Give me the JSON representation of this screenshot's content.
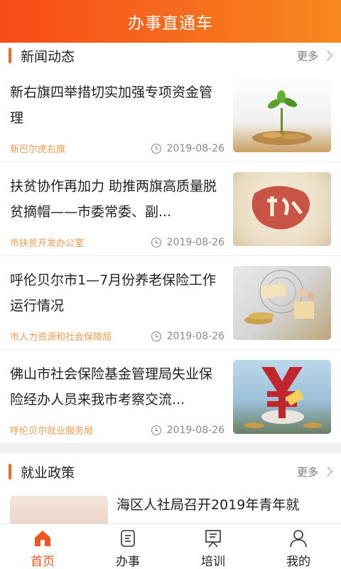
{
  "header": {
    "title": "办事直通车"
  },
  "sections": [
    {
      "title": "新闻动态",
      "more_label": "更多",
      "items": [
        {
          "title": "新右旗四举措切实加强专项资金管理",
          "source": "新巴尔虎右旗",
          "date": "2019-08-26",
          "thumb_icon": "money-plant-image"
        },
        {
          "title": "扶贫协作再加力 助推两旗高质量脱贫摘帽——市委常委、副...",
          "source": "市扶贫开发办公室",
          "date": "2019-08-26",
          "thumb_icon": "poverty-relief-image"
        },
        {
          "title": "呼伦贝尔市1—7月份养老保险工作运行情况",
          "source": "市人力资源和社会保障局",
          "date": "2019-08-26",
          "thumb_icon": "pension-image"
        },
        {
          "title": "佛山市社会保险基金管理局失业保险经办人员来我市考察交流...",
          "source": "呼伦贝尔就业服务局",
          "date": "2019-08-26",
          "thumb_icon": "unemployment-insurance-image"
        }
      ]
    },
    {
      "title": "就业政策",
      "more_label": "更多",
      "items": [
        {
          "title": "海区人社局召开2019年青年就",
          "thumb_icon": "meeting-image"
        }
      ]
    }
  ],
  "tabbar": {
    "items": [
      {
        "label": "首页",
        "icon": "home-icon",
        "active": true
      },
      {
        "label": "办事",
        "icon": "document-icon",
        "active": false
      },
      {
        "label": "培训",
        "icon": "training-icon",
        "active": false
      },
      {
        "label": "我的",
        "icon": "profile-icon",
        "active": false
      }
    ]
  },
  "colors": {
    "accent": "#f4561d",
    "source_text": "#f19a4a"
  }
}
